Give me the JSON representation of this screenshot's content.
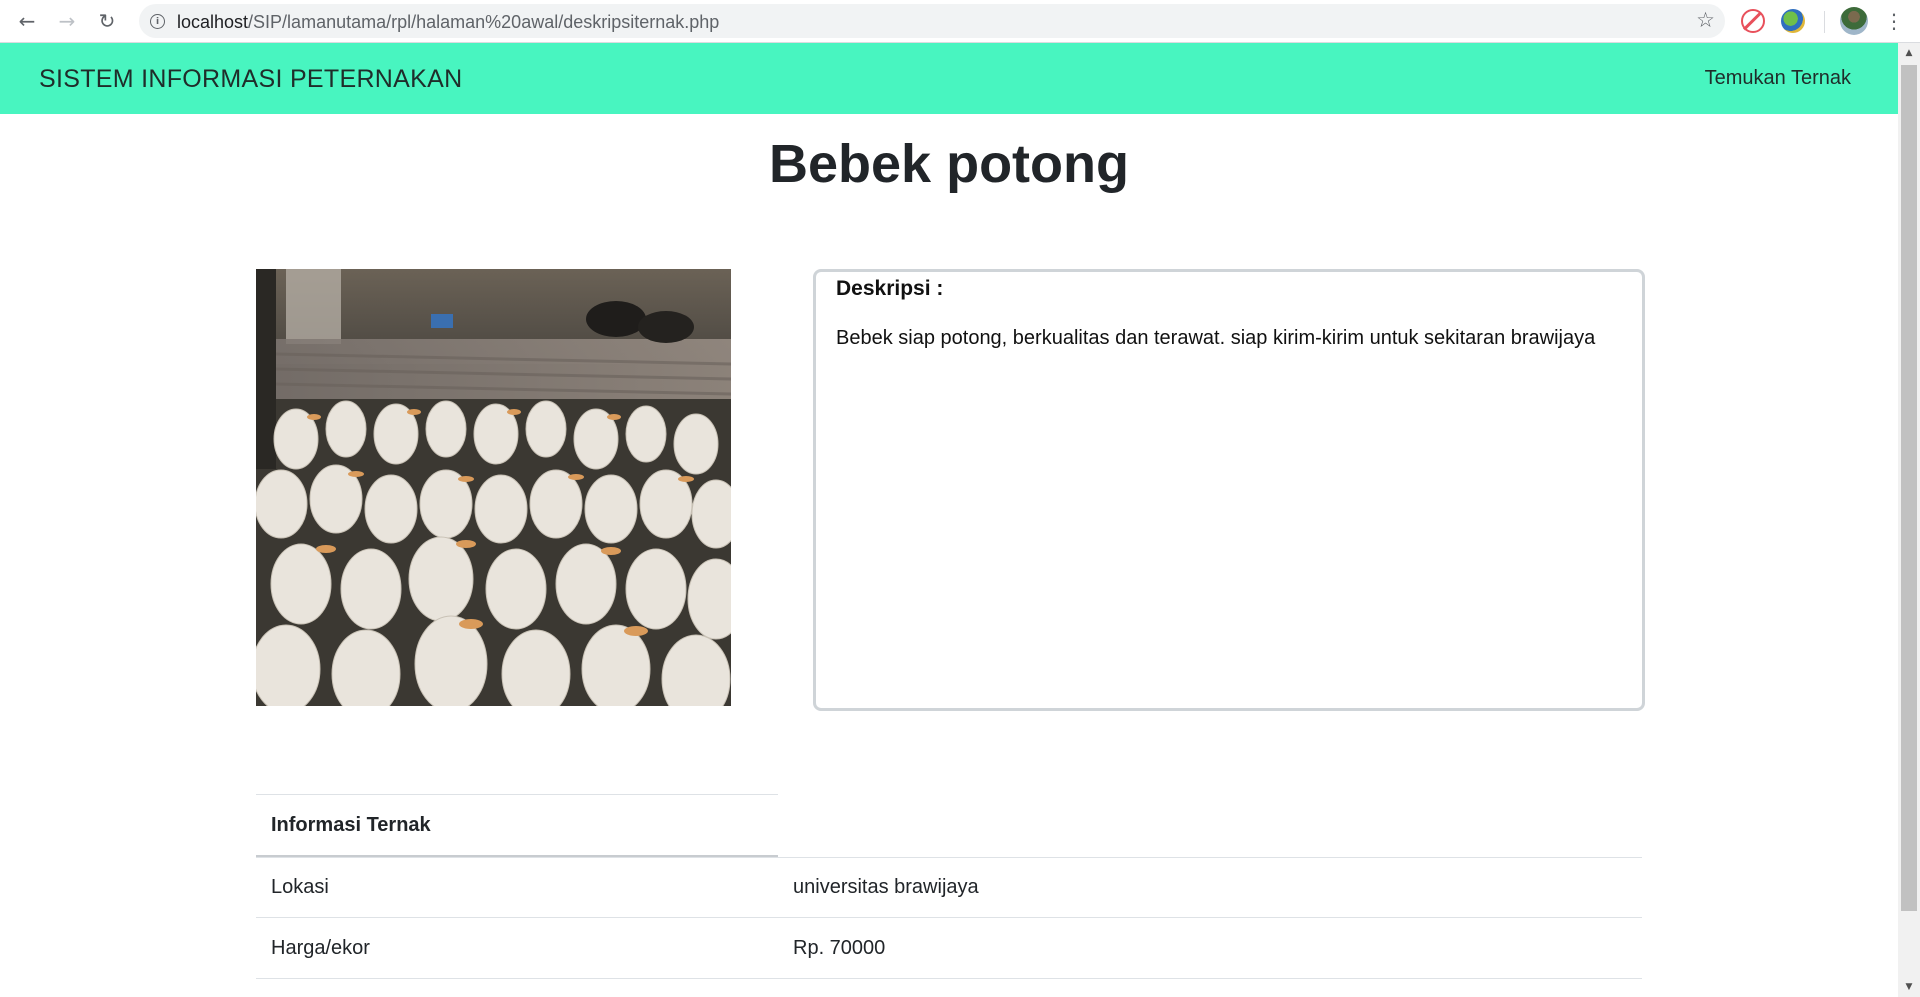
{
  "browser": {
    "url_host": "localhost",
    "url_path": "/SIP/lamanutama/rpl/halaman%20awal/deskripsiternak.php",
    "icons": [
      "back-arrow-icon",
      "forward-arrow-icon",
      "reload-icon",
      "info-icon",
      "star-icon",
      "extension-icon",
      "extension-icon",
      "profile-avatar",
      "kebab-menu-icon"
    ]
  },
  "navbar": {
    "brand": "SISTEM INFORMASI PETERNAKAN",
    "link": "Temukan Ternak",
    "bg_color": "#48f5c0"
  },
  "page": {
    "title": "Bebek potong",
    "photo": "ducks-photo",
    "description_label": "Deskripsi :",
    "description_text": "Bebek siap potong, berkualitas dan terawat. siap kirim-kirim untuk sekitaran brawijaya"
  },
  "info": {
    "header": "Informasi Ternak",
    "rows": [
      {
        "key": "Lokasi",
        "value": "universitas brawijaya"
      },
      {
        "key": "Harga/ekor",
        "value": "Rp. 70000"
      }
    ]
  }
}
